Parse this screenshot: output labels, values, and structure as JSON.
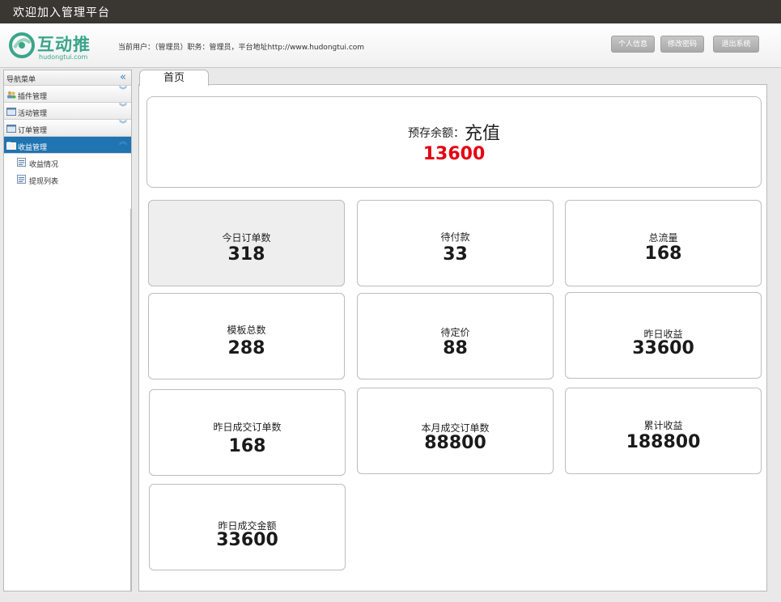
{
  "window": {
    "title": "欢迎加入管理平台"
  },
  "logo": {
    "name": "互动推",
    "domain": "hudongtui.com"
  },
  "header": {
    "user_info": "当前用户：（管理员）职务：管理员，平台地址http://www.hudongtui.com",
    "buttons": {
      "profile": "个人信息",
      "change_password": "修改密码",
      "logout": "退出系统"
    }
  },
  "sidebar": {
    "title": "导航菜单",
    "items": [
      {
        "label": "插件管理"
      },
      {
        "label": "活动管理"
      },
      {
        "label": "订单管理"
      },
      {
        "label": "收益管理"
      }
    ],
    "subitems": [
      {
        "label": "收益情况"
      },
      {
        "label": "提现列表"
      }
    ]
  },
  "tab": {
    "label": "首页"
  },
  "balance": {
    "label": "预存余额：",
    "action": "充值",
    "value": "13600"
  },
  "stats": [
    {
      "label": "今日订单数",
      "value": "318"
    },
    {
      "label": "待付款",
      "value": "33"
    },
    {
      "label": "总流量",
      "value": "168"
    },
    {
      "label": "模板总数",
      "value": "288"
    },
    {
      "label": "待定价",
      "value": "88"
    },
    {
      "label": "昨日收益",
      "value": "33600"
    },
    {
      "label": "昨日成交订单数",
      "value": "168"
    },
    {
      "label": "本月成交订单数",
      "value": "88800"
    },
    {
      "label": "累计收益",
      "value": "188800"
    },
    {
      "label": "昨日成交金额",
      "value": "33600"
    }
  ],
  "colors": {
    "topbar": "#3a3632",
    "accent": "#1f74b1",
    "balance_value": "#e60012",
    "brand": "#3aa58a"
  }
}
